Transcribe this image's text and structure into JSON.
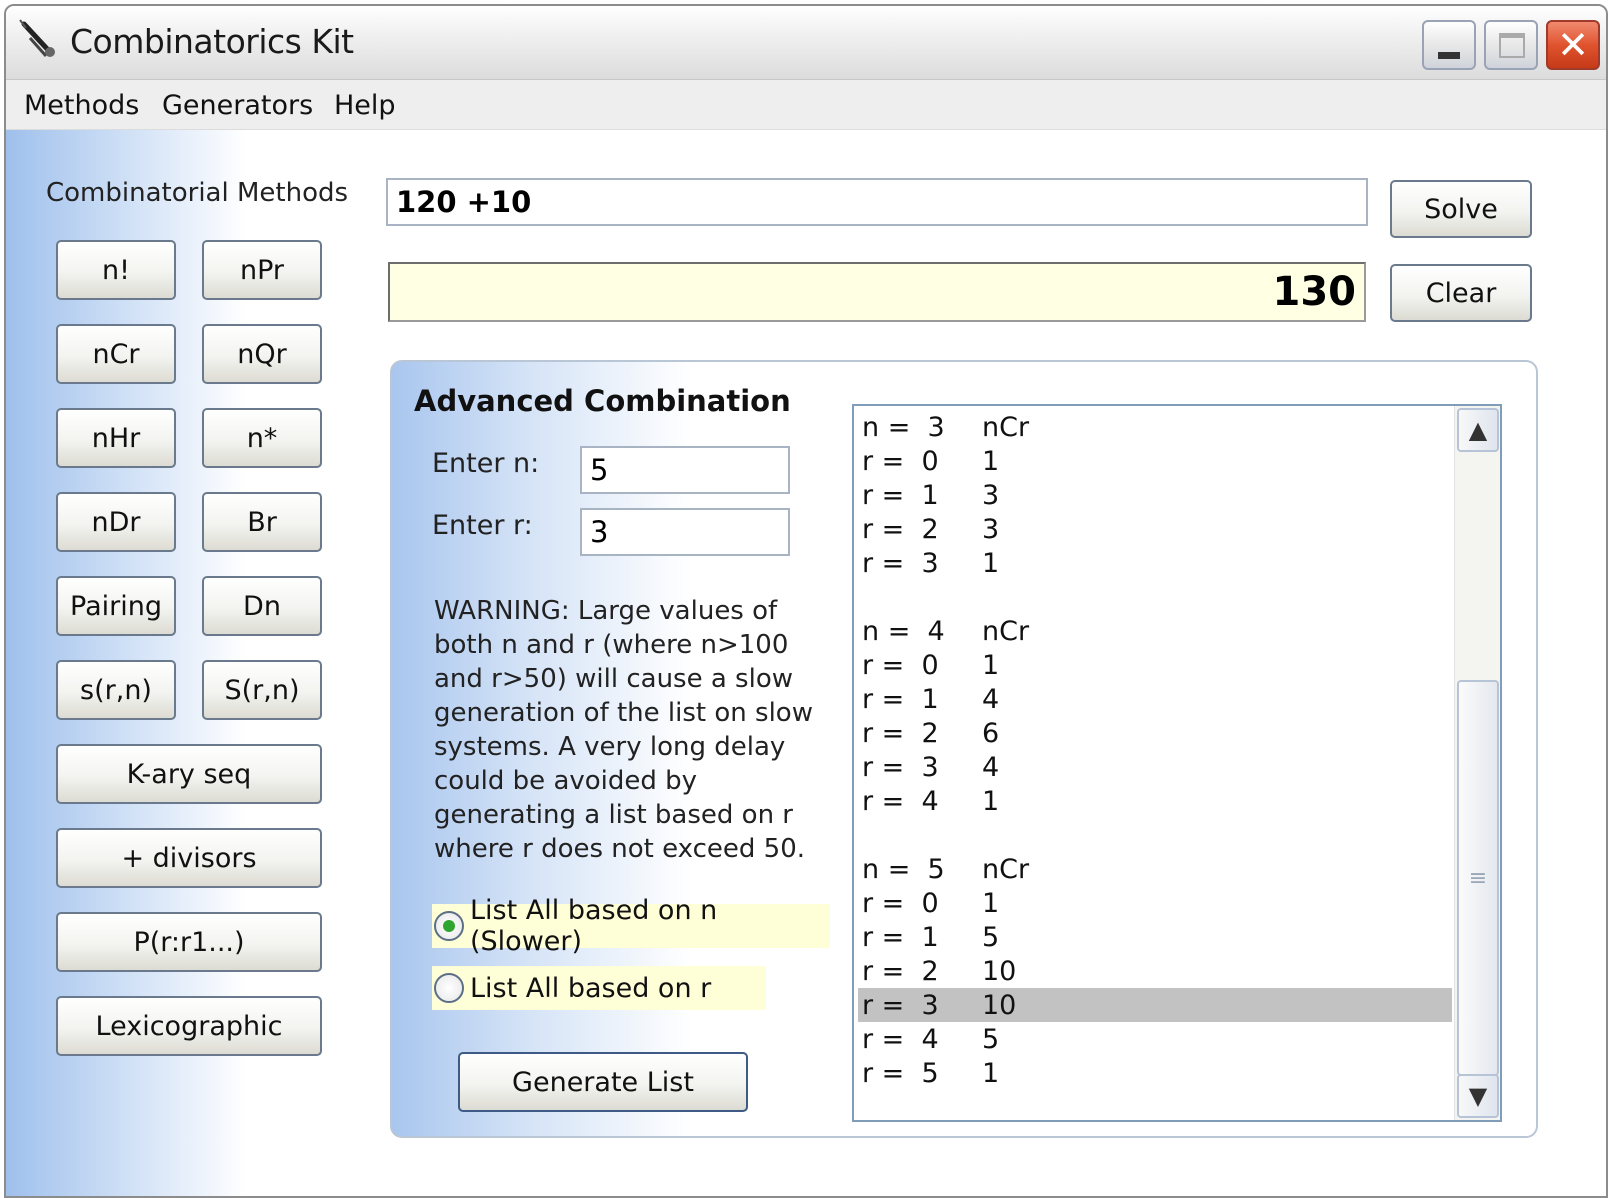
{
  "window": {
    "title": "Combinatorics Kit"
  },
  "menu": {
    "methods": "Methods",
    "generators": "Generators",
    "help": "Help"
  },
  "sidebar": {
    "heading": "Combinatorial Methods",
    "buttons": [
      "n!",
      "nPr",
      "nCr",
      "nQr",
      "nHr",
      "n*",
      "nDr",
      "Br",
      "Pairing",
      "Dn",
      "s(r,n)",
      "S(r,n)",
      "K-ary seq",
      "+ divisors",
      "P(r:r1...)",
      "Lexicographic"
    ]
  },
  "calculator": {
    "expression": "120 +10",
    "result": "130",
    "solve_label": "Solve",
    "clear_label": "Clear"
  },
  "advanced": {
    "title": "Advanced Combination",
    "n_label": "Enter n:",
    "n_value": "5",
    "r_label": "Enter r:",
    "r_value": "3",
    "warning": "WARNING: Large values of both n and r (where n>100 and r>50) will cause a slow generation of the list on slow systems. A very long delay could be avoided by generating a list based on r where r does not exceed 50.",
    "radio_n": "List All based on n (Slower)",
    "radio_r": "List All based on r",
    "radio_selected": "n",
    "generate_label": "Generate List"
  },
  "list": {
    "rows": [
      [
        "n =  3",
        "nCr"
      ],
      [
        "r =  0",
        "1"
      ],
      [
        "r =  1",
        "3"
      ],
      [
        "r =  2",
        "3"
      ],
      [
        "r =  3",
        "1"
      ],
      [
        "",
        ""
      ],
      [
        "n =  4",
        "nCr"
      ],
      [
        "r =  0",
        "1"
      ],
      [
        "r =  1",
        "4"
      ],
      [
        "r =  2",
        "6"
      ],
      [
        "r =  3",
        "4"
      ],
      [
        "r =  4",
        "1"
      ],
      [
        "",
        ""
      ],
      [
        "n =  5",
        "nCr"
      ],
      [
        "r =  0",
        "1"
      ],
      [
        "r =  1",
        "5"
      ],
      [
        "r =  2",
        "10"
      ],
      [
        "r =  3",
        "10"
      ],
      [
        "r =  4",
        "5"
      ],
      [
        "r =  5",
        "1"
      ]
    ],
    "selected_index": 17
  },
  "icons": {
    "app": "compass-icon",
    "minimize": "minimize-icon",
    "maximize": "maximize-icon",
    "close": "close-icon",
    "scroll_up": "chevron-up-icon",
    "scroll_down": "chevron-down-icon"
  }
}
